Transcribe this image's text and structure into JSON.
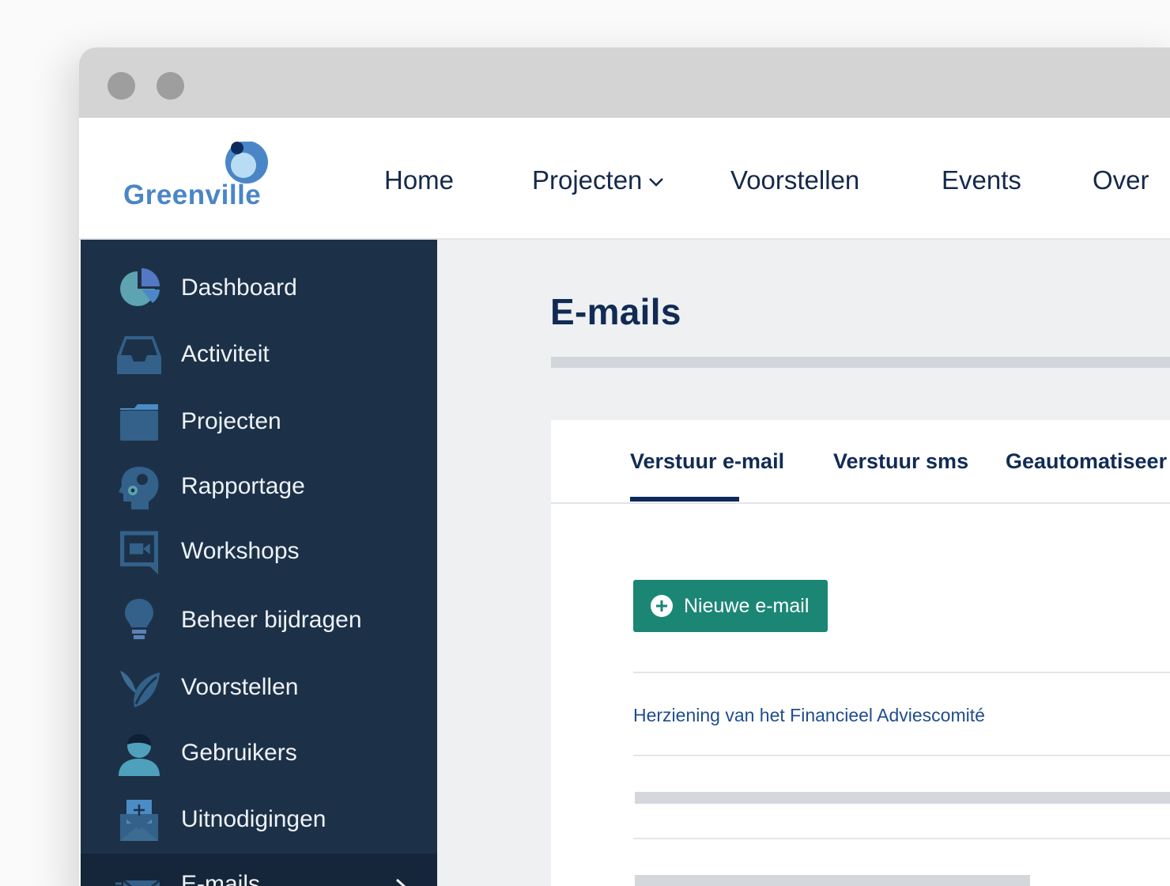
{
  "brand": {
    "name": "Greenville"
  },
  "nav": {
    "home": "Home",
    "projects": "Projecten",
    "proposals": "Voorstellen",
    "events": "Events",
    "about": "Over"
  },
  "sidebar": {
    "items": [
      {
        "label": "Dashboard",
        "icon": "pie-chart-icon"
      },
      {
        "label": "Activiteit",
        "icon": "inbox-tray-icon"
      },
      {
        "label": "Projecten",
        "icon": "folder-icon"
      },
      {
        "label": "Rapportage",
        "icon": "brain-gears-icon"
      },
      {
        "label": "Workshops",
        "icon": "video-chat-icon"
      },
      {
        "label": "Beheer bijdragen",
        "icon": "lightbulb-icon"
      },
      {
        "label": "Voorstellen",
        "icon": "leaf-icon"
      },
      {
        "label": "Gebruikers",
        "icon": "user-icon"
      },
      {
        "label": "Uitnodigingen",
        "icon": "envelope-plus-icon"
      },
      {
        "label": "E-mails",
        "icon": "envelope-icon",
        "active": true
      }
    ]
  },
  "main": {
    "title": "E-mails",
    "tabs": [
      "Verstuur e-mail",
      "Verstuur sms",
      "Geautomatiseer"
    ],
    "active_tab": 0,
    "new_button": "Nieuwe e-mail",
    "emails": [
      {
        "subject": "Herziening van het Financieel Adviescomité"
      }
    ]
  },
  "colors": {
    "sidebar_bg": "#1c3148",
    "sidebar_active_bg": "#15263a",
    "primary_button": "#1b8674",
    "title_text": "#112b54",
    "link_text": "#1f4d8f",
    "logo_blue": "#4a86c7"
  }
}
